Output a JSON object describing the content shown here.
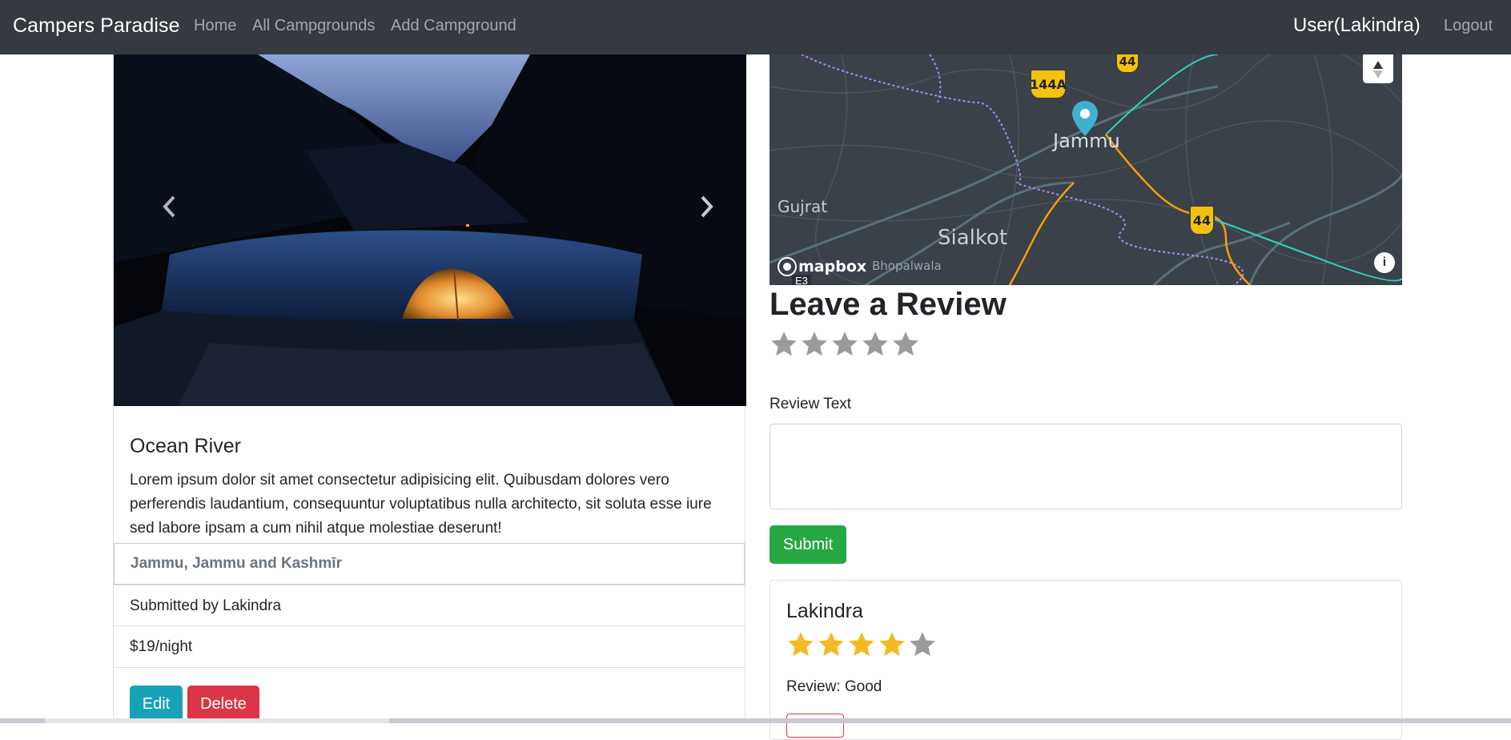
{
  "navbar": {
    "brand": "Campers Paradise",
    "links": [
      "Home",
      "All Campgrounds",
      "Add Campground"
    ],
    "user": "User(Lakindra)",
    "logout": "Logout",
    "bg_color": "#343a40"
  },
  "campground": {
    "title": "Ocean River",
    "description": "Lorem ipsum dolor sit amet consectetur adipisicing elit. Quibusdam dolores vero perferendis laudantium, consequuntur voluptatibus nulla architecto, sit soluta esse iure sed labore ipsam a cum nihil atque molestiae deserunt!",
    "location": "Jammu, Jammu and Kashmīr",
    "submitted_by": "Submitted by Lakindra",
    "price": "$19/night",
    "edit_label": "Edit",
    "delete_label": "Delete",
    "carousel_prev_icon": "chevron-left-icon",
    "carousel_next_icon": "chevron-right-icon"
  },
  "map": {
    "labels": {
      "jammu": "Jammu",
      "gujrat": "Gujrat",
      "sialkot": "Sialkot",
      "bhopalwala": "Bhopalwala"
    },
    "shields": [
      "144A",
      "44",
      "44"
    ],
    "road_label": "E3",
    "attribution": "mapbox",
    "info_icon": "info-icon",
    "compass_icon": "compass-icon",
    "marker_color": "#3fb1ce"
  },
  "review_form": {
    "heading": "Leave a Review",
    "rating": 0,
    "max_rating": 5,
    "text_label": "Review Text",
    "text_value": "",
    "submit_label": "Submit"
  },
  "reviews": [
    {
      "author": "Lakindra",
      "rating": 4,
      "max_rating": 5,
      "text": "Review: Good"
    }
  ],
  "colors": {
    "edit": "#17a2b8",
    "delete": "#dc3545",
    "submit": "#28a745",
    "star_filled": "#f5b921",
    "star_empty": "#9a9a9a"
  }
}
